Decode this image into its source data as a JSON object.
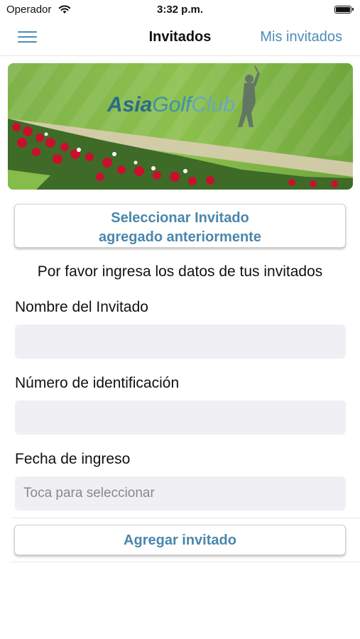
{
  "status": {
    "carrier": "Operador",
    "time": "3:32 p.m."
  },
  "nav": {
    "title": "Invitados",
    "right_link": "Mis invitados"
  },
  "banner": {
    "logo_part1": "Asia",
    "logo_part2": "Golf",
    "logo_part3": "Club"
  },
  "select_button": {
    "line1": "Seleccionar Invitado",
    "line2": "agregado anteriormente"
  },
  "intro": "Por favor ingresa los datos de tus invitados",
  "form": {
    "name_label": "Nombre del Invitado",
    "id_label": "Número de identificación",
    "date_label": "Fecha de ingreso",
    "date_placeholder": "Toca para seleccionar"
  },
  "add_button": "Agregar invitado",
  "colors": {
    "accent": "#4a86ad",
    "field_bg": "#efeff4"
  }
}
